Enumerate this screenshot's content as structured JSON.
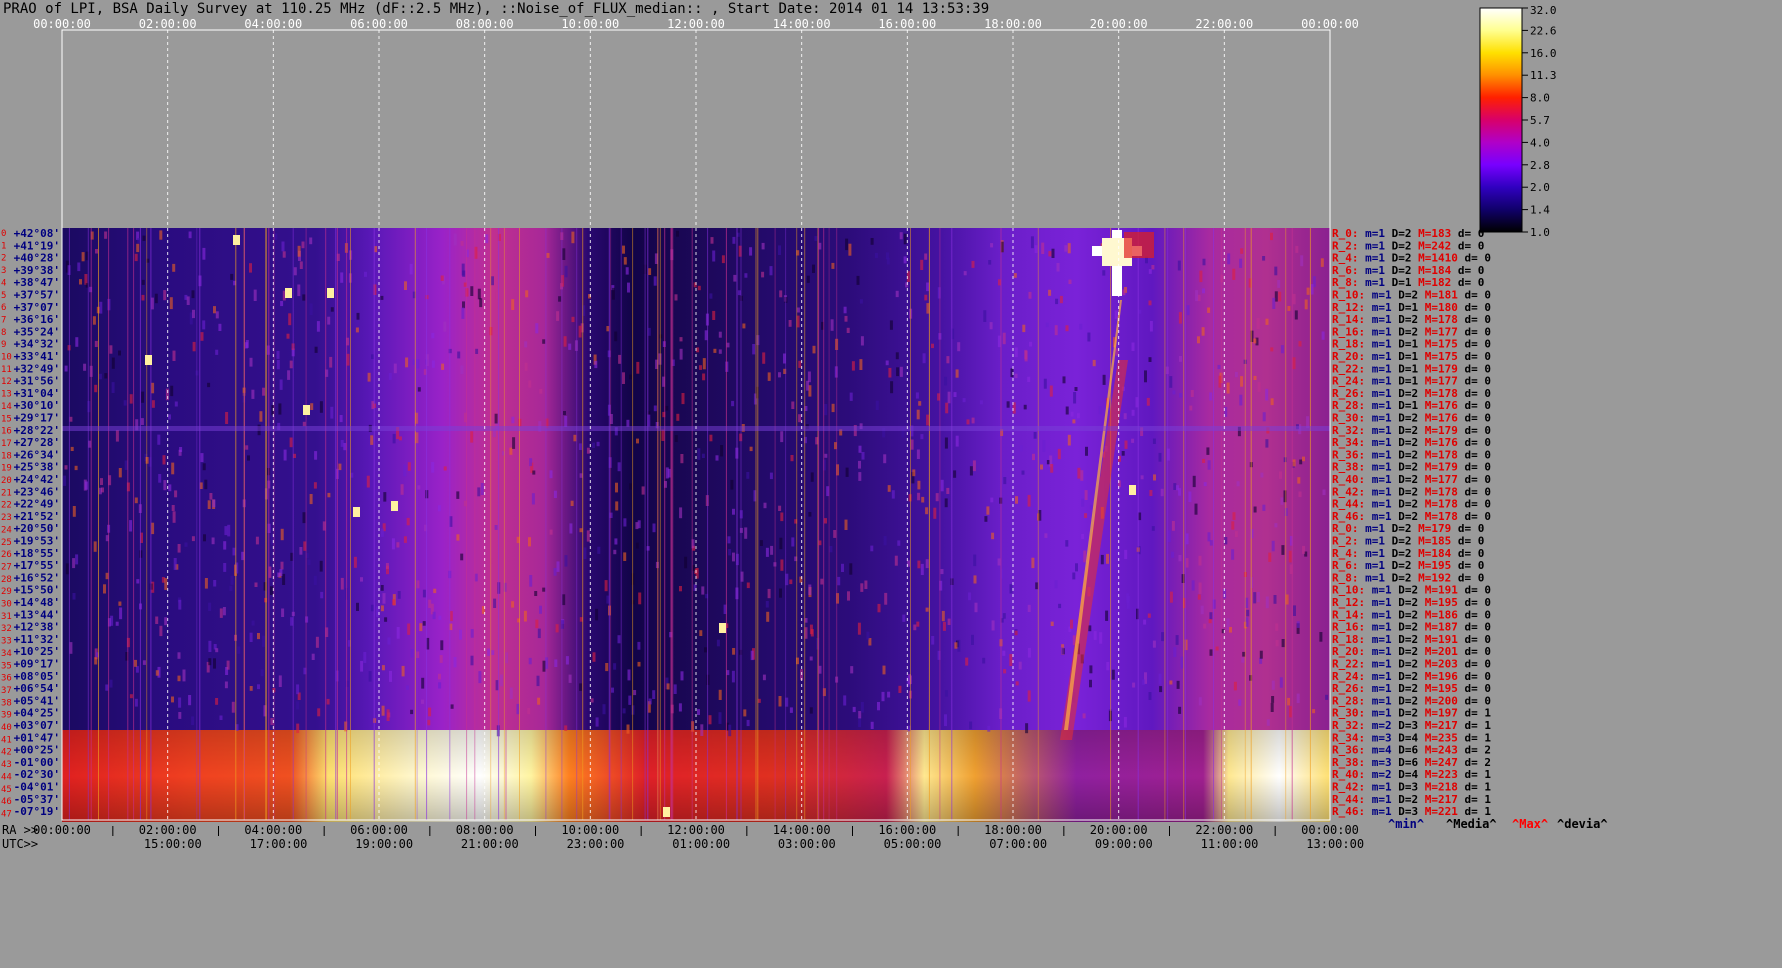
{
  "title": "PRAO of LPI, BSA Daily Survey at 110.25 MHz (dF::2.5 MHz), ::Noise_of_FLUX_median:: , Start Date: 2014 01 14 13:53:39",
  "chart_data": {
    "type": "heatmap",
    "top_axis_ticks": [
      "00:00:00",
      "02:00:00",
      "04:00:00",
      "06:00:00",
      "08:00:00",
      "10:00:00",
      "12:00:00",
      "14:00:00",
      "16:00:00",
      "18:00:00",
      "20:00:00",
      "22:00:00",
      "00:00:00"
    ],
    "bottom_ra_label": "RA >>",
    "bottom_ra_ticks": [
      "00:00:00",
      "02:00:00",
      "04:00:00",
      "06:00:00",
      "08:00:00",
      "10:00:00",
      "12:00:00",
      "14:00:00",
      "16:00:00",
      "18:00:00",
      "20:00:00",
      "22:00:00",
      "00:00:00"
    ],
    "bottom_utc_label": "UTC>>",
    "bottom_utc_ticks": [
      "15:00:00",
      "17:00:00",
      "19:00:00",
      "21:00:00",
      "23:00:00",
      "01:00:00",
      "03:00:00",
      "05:00:00",
      "07:00:00",
      "09:00:00",
      "11:00:00",
      "13:00:00"
    ],
    "declinations": [
      "+42°08'",
      "+41°19'",
      "+40°28'",
      "+39°38'",
      "+38°47'",
      "+37°57'",
      "+37°07'",
      "+36°16'",
      "+35°24'",
      "+34°32'",
      "+33°41'",
      "+32°49'",
      "+31°56'",
      "+31°04'",
      "+30°10'",
      "+29°17'",
      "+28°22'",
      "+27°28'",
      "+26°34'",
      "+25°38'",
      "+24°42'",
      "+23°46'",
      "+22°49'",
      "+21°52'",
      "+20°50'",
      "+19°53'",
      "+18°55'",
      "+17°55'",
      "+16°52'",
      "+15°50'",
      "+14°48'",
      "+13°44'",
      "+12°38'",
      "+11°32'",
      "+10°25'",
      "+09°17'",
      "+08°05'",
      "+06°54'",
      "+05°41'",
      "+04°25'",
      "+03°07'",
      "+01°47'",
      "+00°25'",
      "-01°00'",
      "-02°30'",
      "-04°01'",
      "-05°37'",
      "-07°19'"
    ],
    "row_numbers": [
      "0",
      "1",
      "2",
      "3",
      "4",
      "5",
      "6",
      "7",
      "8",
      "9",
      "10",
      "11",
      "12",
      "13",
      "14",
      "15",
      "16",
      "17",
      "18",
      "19",
      "20",
      "21",
      "22",
      "23",
      "24",
      "25",
      "26",
      "27",
      "28",
      "29",
      "30",
      "31",
      "32",
      "33",
      "34",
      "35",
      "36",
      "37",
      "38",
      "39",
      "40",
      "41",
      "42",
      "43",
      "44",
      "45",
      "46",
      "47"
    ],
    "row_stats": [
      {
        "r": "R_0:",
        "m": "m=1",
        "D": "D=2",
        "M": "M=183",
        "d": "d= 0"
      },
      {
        "r": "R_2:",
        "m": "m=1",
        "D": "D=2",
        "M": "M=242",
        "d": "d= 0"
      },
      {
        "r": "R_4:",
        "m": "m=1",
        "D": "D=2",
        "M": "M=1410",
        "d": "d= 0"
      },
      {
        "r": "R_6:",
        "m": "m=1",
        "D": "D=2",
        "M": "M=184",
        "d": "d= 0"
      },
      {
        "r": "R_8:",
        "m": "m=1",
        "D": "D=1",
        "M": "M=182",
        "d": "d= 0"
      },
      {
        "r": "R_10:",
        "m": "m=1",
        "D": "D=2",
        "M": "M=181",
        "d": "d= 0"
      },
      {
        "r": "R_12:",
        "m": "m=1",
        "D": "D=1",
        "M": "M=180",
        "d": "d= 0"
      },
      {
        "r": "R_14:",
        "m": "m=1",
        "D": "D=2",
        "M": "M=178",
        "d": "d= 0"
      },
      {
        "r": "R_16:",
        "m": "m=1",
        "D": "D=2",
        "M": "M=177",
        "d": "d= 0"
      },
      {
        "r": "R_18:",
        "m": "m=1",
        "D": "D=1",
        "M": "M=175",
        "d": "d= 0"
      },
      {
        "r": "R_20:",
        "m": "m=1",
        "D": "D=1",
        "M": "M=175",
        "d": "d= 0"
      },
      {
        "r": "R_22:",
        "m": "m=1",
        "D": "D=1",
        "M": "M=179",
        "d": "d= 0"
      },
      {
        "r": "R_24:",
        "m": "m=1",
        "D": "D=1",
        "M": "M=177",
        "d": "d= 0"
      },
      {
        "r": "R_26:",
        "m": "m=1",
        "D": "D=2",
        "M": "M=178",
        "d": "d= 0"
      },
      {
        "r": "R_28:",
        "m": "m=1",
        "D": "D=1",
        "M": "M=176",
        "d": "d= 0"
      },
      {
        "r": "R_30:",
        "m": "m=1",
        "D": "D=2",
        "M": "M=176",
        "d": "d= 0"
      },
      {
        "r": "R_32:",
        "m": "m=1",
        "D": "D=2",
        "M": "M=179",
        "d": "d= 0"
      },
      {
        "r": "R_34:",
        "m": "m=1",
        "D": "D=2",
        "M": "M=176",
        "d": "d= 0"
      },
      {
        "r": "R_36:",
        "m": "m=1",
        "D": "D=2",
        "M": "M=178",
        "d": "d= 0"
      },
      {
        "r": "R_38:",
        "m": "m=1",
        "D": "D=2",
        "M": "M=179",
        "d": "d= 0"
      },
      {
        "r": "R_40:",
        "m": "m=1",
        "D": "D=2",
        "M": "M=177",
        "d": "d= 0"
      },
      {
        "r": "R_42:",
        "m": "m=1",
        "D": "D=2",
        "M": "M=178",
        "d": "d= 0"
      },
      {
        "r": "R_44:",
        "m": "m=1",
        "D": "D=2",
        "M": "M=178",
        "d": "d= 0"
      },
      {
        "r": "R_46:",
        "m": "m=1",
        "D": "D=2",
        "M": "M=178",
        "d": "d= 0"
      },
      {
        "r": "R_0:",
        "m": "m=1",
        "D": "D=2",
        "M": "M=179",
        "d": "d= 0"
      },
      {
        "r": "R_2:",
        "m": "m=1",
        "D": "D=2",
        "M": "M=185",
        "d": "d= 0"
      },
      {
        "r": "R_4:",
        "m": "m=1",
        "D": "D=2",
        "M": "M=184",
        "d": "d= 0"
      },
      {
        "r": "R_6:",
        "m": "m=1",
        "D": "D=2",
        "M": "M=195",
        "d": "d= 0"
      },
      {
        "r": "R_8:",
        "m": "m=1",
        "D": "D=2",
        "M": "M=192",
        "d": "d= 0"
      },
      {
        "r": "R_10:",
        "m": "m=1",
        "D": "D=2",
        "M": "M=191",
        "d": "d= 0"
      },
      {
        "r": "R_12:",
        "m": "m=1",
        "D": "D=2",
        "M": "M=195",
        "d": "d= 0"
      },
      {
        "r": "R_14:",
        "m": "m=1",
        "D": "D=2",
        "M": "M=186",
        "d": "d= 0"
      },
      {
        "r": "R_16:",
        "m": "m=1",
        "D": "D=2",
        "M": "M=187",
        "d": "d= 0"
      },
      {
        "r": "R_18:",
        "m": "m=1",
        "D": "D=2",
        "M": "M=191",
        "d": "d= 0"
      },
      {
        "r": "R_20:",
        "m": "m=1",
        "D": "D=2",
        "M": "M=201",
        "d": "d= 0"
      },
      {
        "r": "R_22:",
        "m": "m=1",
        "D": "D=2",
        "M": "M=203",
        "d": "d= 0"
      },
      {
        "r": "R_24:",
        "m": "m=1",
        "D": "D=2",
        "M": "M=196",
        "d": "d= 0"
      },
      {
        "r": "R_26:",
        "m": "m=1",
        "D": "D=2",
        "M": "M=195",
        "d": "d= 0"
      },
      {
        "r": "R_28:",
        "m": "m=1",
        "D": "D=2",
        "M": "M=200",
        "d": "d= 0"
      },
      {
        "r": "R_30:",
        "m": "m=1",
        "D": "D=2",
        "M": "M=197",
        "d": "d= 1"
      },
      {
        "r": "R_32:",
        "m": "m=2",
        "D": "D=3",
        "M": "M=217",
        "d": "d= 1"
      },
      {
        "r": "R_34:",
        "m": "m=3",
        "D": "D=4",
        "M": "M=235",
        "d": "d= 1"
      },
      {
        "r": "R_36:",
        "m": "m=4",
        "D": "D=6",
        "M": "M=243",
        "d": "d= 2"
      },
      {
        "r": "R_38:",
        "m": "m=3",
        "D": "D=6",
        "M": "M=247",
        "d": "d= 2"
      },
      {
        "r": "R_40:",
        "m": "m=2",
        "D": "D=4",
        "M": "M=223",
        "d": "d= 1"
      },
      {
        "r": "R_42:",
        "m": "m=1",
        "D": "D=3",
        "M": "M=218",
        "d": "d= 1"
      },
      {
        "r": "R_44:",
        "m": "m=1",
        "D": "D=2",
        "M": "M=217",
        "d": "d= 1"
      },
      {
        "r": "R_46:",
        "m": "m=1",
        "D": "D=3",
        "M": "M=221",
        "d": "d= 1"
      }
    ],
    "colorbar_ticks": [
      "32.0",
      "22.6",
      "16.0",
      "11.3",
      "8.0",
      "5.7",
      "4.0",
      "2.8",
      "2.0",
      "1.4",
      "1.0"
    ],
    "colorbar_colors": [
      "#ffffff",
      "#ffff90",
      "#ffe000",
      "#ff9000",
      "#ff2000",
      "#d8006a",
      "#b000c8",
      "#7800ff",
      "#3000c0",
      "#10006a",
      "#000000"
    ],
    "legend": {
      "min": {
        "label": "^min^",
        "color": "#000080"
      },
      "median": {
        "label": "^Media^",
        "color": "#000000"
      },
      "max": {
        "label": "^Max^",
        "color": "#ff0000"
      },
      "devia": {
        "label": "^devia^",
        "color": "#000000"
      }
    }
  }
}
